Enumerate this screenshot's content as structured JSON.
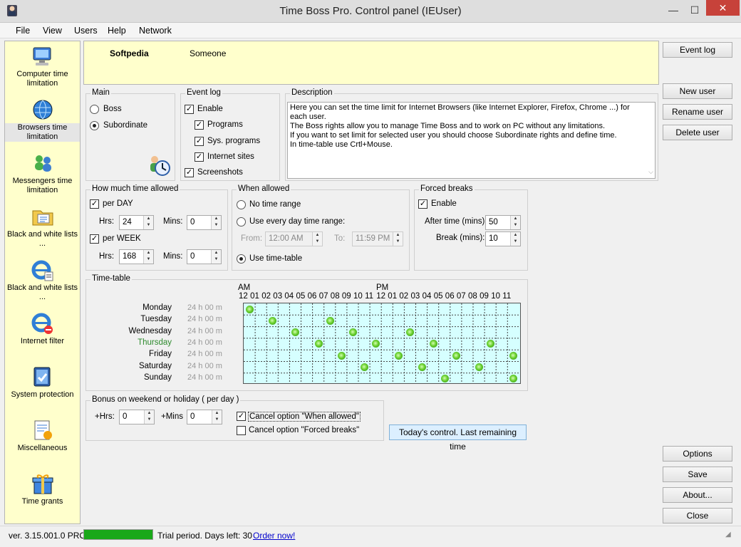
{
  "window": {
    "title": "Time Boss Pro. Control panel (IEUser)",
    "close": "✕",
    "minimize": "—",
    "maximize": "☐"
  },
  "menu": [
    "File",
    "View",
    "Users",
    "Help",
    "Network"
  ],
  "sidebar": [
    {
      "label": "Computer time limitation",
      "icon": "computer-icon"
    },
    {
      "label": "Browsers time limitation",
      "icon": "globe-icon",
      "selected": true
    },
    {
      "label": "Messengers time limitation",
      "icon": "messenger-icon"
    },
    {
      "label": "Black and white lists ...",
      "icon": "folder-list-icon"
    },
    {
      "label": "Black and white lists ...",
      "icon": "ie-list-icon"
    },
    {
      "label": "Internet filter",
      "icon": "ie-filter-icon"
    },
    {
      "label": "System protection",
      "icon": "shield-icon"
    },
    {
      "label": "Miscellaneous",
      "icon": "note-icon"
    },
    {
      "label": "Time grants",
      "icon": "gift-icon"
    }
  ],
  "user": {
    "name": "Softpedia",
    "full_name": "Someone"
  },
  "main": {
    "title": "Main",
    "boss": "Boss",
    "subordinate": "Subordinate",
    "selected": "Subordinate"
  },
  "eventlog": {
    "title": "Event log",
    "enable": "Enable",
    "programs": "Programs",
    "sys_programs": "Sys. programs",
    "internet_sites": "Internet sites",
    "screenshots": "Screenshots"
  },
  "description": {
    "title": "Description",
    "text": "Here you can set the time limit for Internet Browsers (like Internet Explorer, Firefox, Chrome ...) for each user.\nThe Boss rights allow you to manage Time Boss and to work on PC without any limitations.\nIf you want to set limit for selected user you should choose Subordinate rights and define time.\nIn time-table use Crtl+Mouse."
  },
  "howmuch": {
    "title": "How much time allowed",
    "per_day": "per DAY",
    "per_week": "per WEEK",
    "hrs": "Hrs:",
    "mins": "Mins:",
    "day_hrs": "24",
    "day_mins": "0",
    "week_hrs": "168",
    "week_mins": "0"
  },
  "whenallowed": {
    "title": "When allowed",
    "no_range": "No time range",
    "every_day": "Use every day time range:",
    "from": "From:",
    "to": "To:",
    "from_val": "12:00 AM",
    "to_val": "11:59 PM",
    "timetable": "Use time-table",
    "selected": "Use time-table"
  },
  "forced": {
    "title": "Forced breaks",
    "enable": "Enable",
    "after": "After time (mins):",
    "break": "Break (mins):",
    "after_val": "50",
    "break_val": "10"
  },
  "timetable": {
    "title": "Time-table",
    "am": "AM",
    "pm": "PM",
    "hours": [
      "12",
      "01",
      "02",
      "03",
      "04",
      "05",
      "06",
      "07",
      "08",
      "09",
      "10",
      "11",
      "12",
      "01",
      "02",
      "03",
      "04",
      "05",
      "06",
      "07",
      "08",
      "09",
      "10",
      "11"
    ],
    "days": [
      {
        "name": "Monday",
        "duration": "24 h 00 m",
        "dots": [
          0
        ]
      },
      {
        "name": "Tuesday",
        "duration": "24 h 00 m",
        "dots": [
          2,
          7
        ]
      },
      {
        "name": "Wednesday",
        "duration": "24 h 00 m",
        "dots": [
          4,
          9,
          14
        ]
      },
      {
        "name": "Thursday",
        "duration": "24 h 00 m",
        "dots": [
          6,
          11,
          16,
          21
        ],
        "today": true,
        "color": "#2d8a2d"
      },
      {
        "name": "Friday",
        "duration": "24 h 00 m",
        "dots": [
          8,
          13,
          18,
          23
        ]
      },
      {
        "name": "Saturday",
        "duration": "24 h 00 m",
        "dots": [
          10,
          15,
          20
        ]
      },
      {
        "name": "Sunday",
        "duration": "24 h 00 m",
        "dots": [
          17,
          23
        ]
      }
    ]
  },
  "bonus": {
    "title": "Bonus on weekend or holiday  ( per day )",
    "hrs": "+Hrs:",
    "mins": "+Mins",
    "hrs_val": "0",
    "mins_val": "0",
    "cancel_when": "Cancel option \"When allowed\"",
    "cancel_forced": "Cancel option \"Forced breaks\""
  },
  "today_button": "Today's control. Last remaining time",
  "right_buttons": {
    "event_log": "Event log",
    "new_user": "New user",
    "rename_user": "Rename user",
    "delete_user": "Delete user",
    "options": "Options",
    "save": "Save",
    "about": "About...",
    "close": "Close"
  },
  "status": {
    "version": "ver. 3.15.001.0 PRO",
    "trial": "Trial period. Days left: 30",
    "order": "Order now!",
    "progress": 1.0
  },
  "colors": {
    "accent_yellow": "#ffffcc",
    "grid": "#d6ffff",
    "progress": "#1aa81a",
    "link": "#0000cc"
  }
}
